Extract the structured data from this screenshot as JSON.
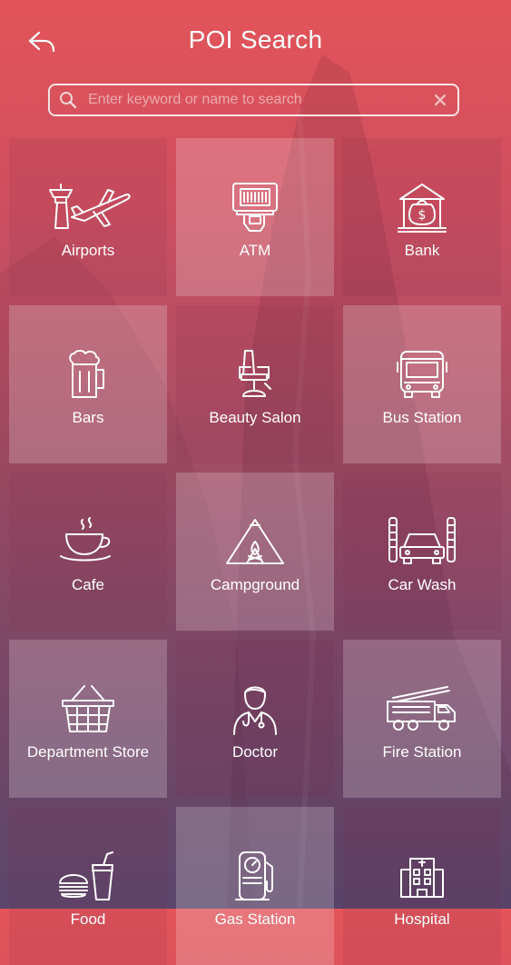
{
  "header": {
    "title": "POI Search"
  },
  "search": {
    "placeholder": "Enter keyword or name to search"
  },
  "categories": [
    {
      "label": "Airports",
      "icon": "airport-icon"
    },
    {
      "label": "ATM",
      "icon": "atm-icon"
    },
    {
      "label": "Bank",
      "icon": "bank-icon"
    },
    {
      "label": "Bars",
      "icon": "beer-mug-icon"
    },
    {
      "label": "Beauty Salon",
      "icon": "salon-chair-icon"
    },
    {
      "label": "Bus Station",
      "icon": "bus-icon"
    },
    {
      "label": "Cafe",
      "icon": "coffee-cup-icon"
    },
    {
      "label": "Campground",
      "icon": "tent-icon"
    },
    {
      "label": "Car Wash",
      "icon": "car-wash-icon"
    },
    {
      "label": "Department Store",
      "icon": "basket-icon"
    },
    {
      "label": "Doctor",
      "icon": "doctor-icon"
    },
    {
      "label": "Fire Station",
      "icon": "fire-truck-icon"
    },
    {
      "label": "Food",
      "icon": "burger-drink-icon"
    },
    {
      "label": "Gas Station",
      "icon": "fuel-pump-icon"
    },
    {
      "label": "Hospital",
      "icon": "hospital-icon"
    }
  ]
}
